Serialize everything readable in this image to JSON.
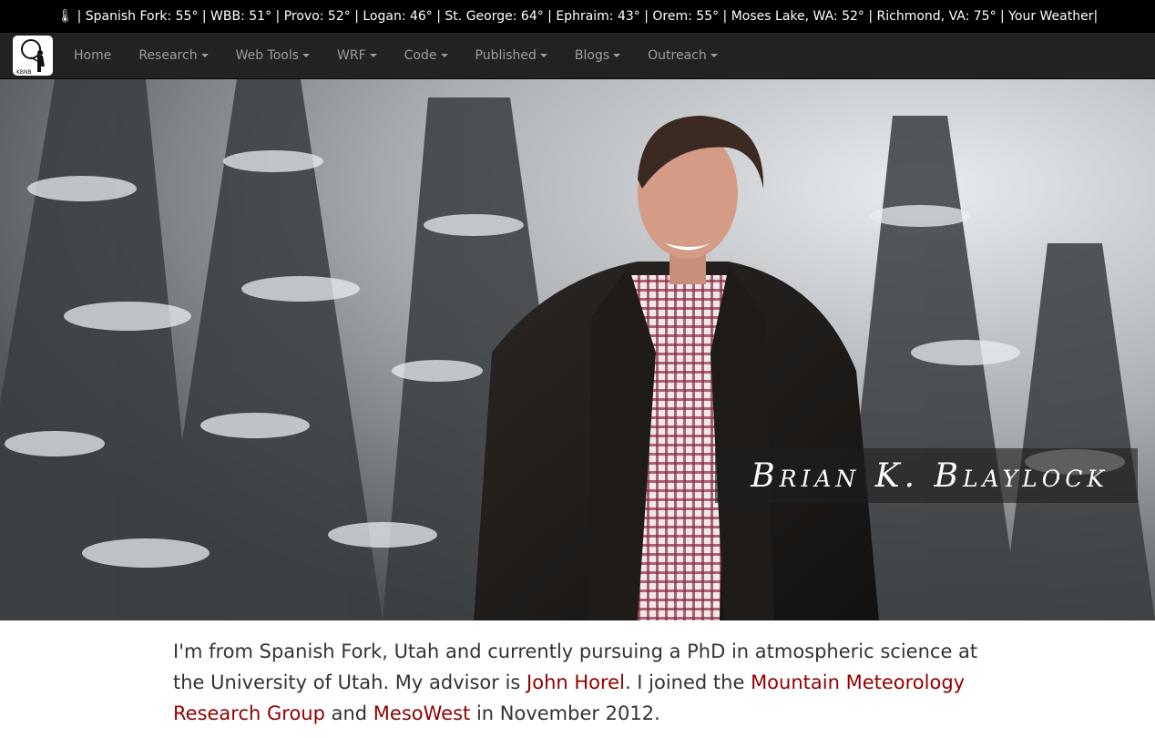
{
  "weather_bar": {
    "icon": "thermometer-icon",
    "text": "| Spanish Fork: 55° | WBB: 51° | Provo: 52° | Logan: 46° | St. George: 64° | Ephraim: 43° | Orem: 55° | Moses Lake, WA: 52° | Richmond, VA: 75° | Your Weather|"
  },
  "navbar": {
    "logo_text": "KBNB",
    "items": [
      {
        "label": "Home",
        "dropdown": false
      },
      {
        "label": "Research",
        "dropdown": true
      },
      {
        "label": "Web Tools",
        "dropdown": true
      },
      {
        "label": "WRF",
        "dropdown": true
      },
      {
        "label": "Code",
        "dropdown": true
      },
      {
        "label": "Published",
        "dropdown": true
      },
      {
        "label": "Blogs",
        "dropdown": true
      },
      {
        "label": "Outreach",
        "dropdown": true
      }
    ]
  },
  "hero": {
    "name": "Brian K. Blaylock"
  },
  "intro": {
    "part1": "I'm from Spanish Fork, Utah and currently pursuing a PhD in atmospheric science at the University of Utah. My advisor is ",
    "link1": "John Horel",
    "part2": ". I joined the ",
    "link2": "Mountain Meteorology Research Group",
    "part3": " and ",
    "link3": "MesoWest",
    "part4": " in November 2012."
  },
  "colors": {
    "link": "#900000",
    "navbar_bg": "#222222",
    "weather_bg": "#000000"
  }
}
